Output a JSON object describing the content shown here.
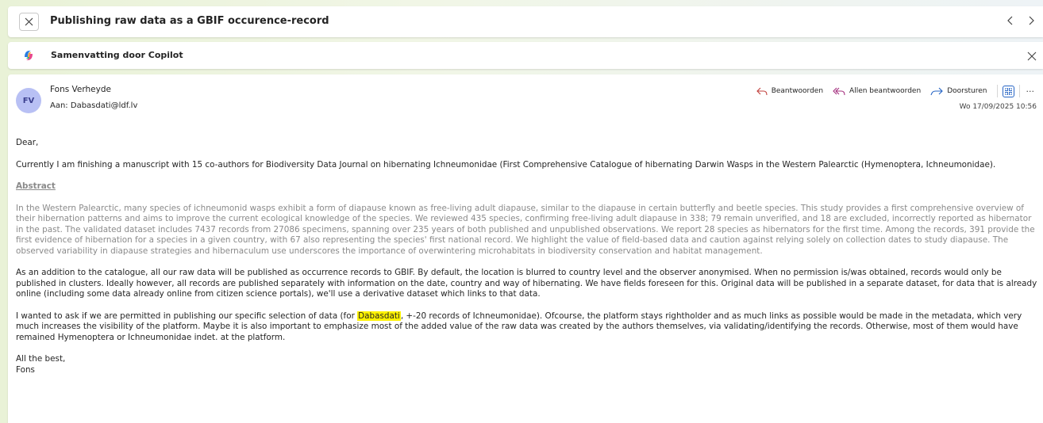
{
  "subject": "Publishing raw data as a GBIF occurence-record",
  "copilot": {
    "label": "Samenvatting door Copilot"
  },
  "sender": {
    "initials": "FV",
    "name": "Fons Verheyde",
    "to_label": "Aan:",
    "to": "Dabasdati@ldf.lv"
  },
  "actions": {
    "reply": "Beantwoorden",
    "reply_all": "Allen beantwoorden",
    "forward": "Doorsturen",
    "more": "···"
  },
  "date": "Wo 17/09/2025 10:56",
  "colors": {
    "accent": "#2664c4",
    "avatar_bg": "#b8c0f4",
    "highlight": "#fff200"
  },
  "body": {
    "greeting": "Dear,",
    "intro": "Currently I am finishing a manuscript with 15 co-authors for Biodiversity Data Journal on hibernating Ichneumonidae (First Comprehensive Catalogue of hibernating Darwin Wasps in the Western Palearctic (Hymenoptera, Ichneumonidae).",
    "abstract_heading": "Abstract",
    "abstract": "In the Western Palearctic, many species of ichneumonid wasps exhibit a form of diapause known as free-living adult diapause, similar to the diapause in certain butterfly and beetle species. This study provides a first comprehensive overview of their hibernation patterns and aims to improve the current ecological knowledge of the species. We reviewed 435 species, confirming free-living adult diapause in 338; 79 remain unverified, and 18 are excluded, incorrectly reported as hibernator in the past. The validated dataset includes 7437 records from 27086 specimens, spanning over 235 years of both published and unpublished observations. We report 28 species as hibernators for the first time. Among the records, 391 provide the first evidence of hibernation for a species in a given country, with 67 also representing the species' first national record. We highlight the value of field-based data and caution against relying solely on collection dates to study diapause. The observed variability in diapause strategies and hibernaculum use underscores the importance of overwintering microhabitats in biodiversity conservation and habitat management.",
    "para2": "As an addition to the catalogue, all our raw data will be published as occurrence records to GBIF. By default, the location is blurred to country level and the observer anonymised. When no permission is/was obtained, records would only be published in clusters. Ideally however, all records are published separately with information on the date, country and way of hibernating. We have fields foreseen for this. Original data will be published in a separate dataset, for data that is already online (including some data already online from citizen science portals), we'll use a derivative dataset which links to that data.",
    "para3_pre": "I wanted to ask if we are permitted in publishing our specific selection of data (for ",
    "para3_highlight": "Dabasdati",
    "para3_post": ", +-20 records of Ichneumonidae). Ofcourse, the platform stays rightholder and as much links as possible would be made in the metadata, which very much increases the visibility of the platform. Maybe it is also important to emphasize most of the added value of the raw data was created by the authors themselves, via validating/identifying the records. Otherwise, most of them would have remained Hymenoptera or Ichneumonidae indet. at the platform.",
    "closing": "All the best,",
    "signature": "Fons"
  }
}
